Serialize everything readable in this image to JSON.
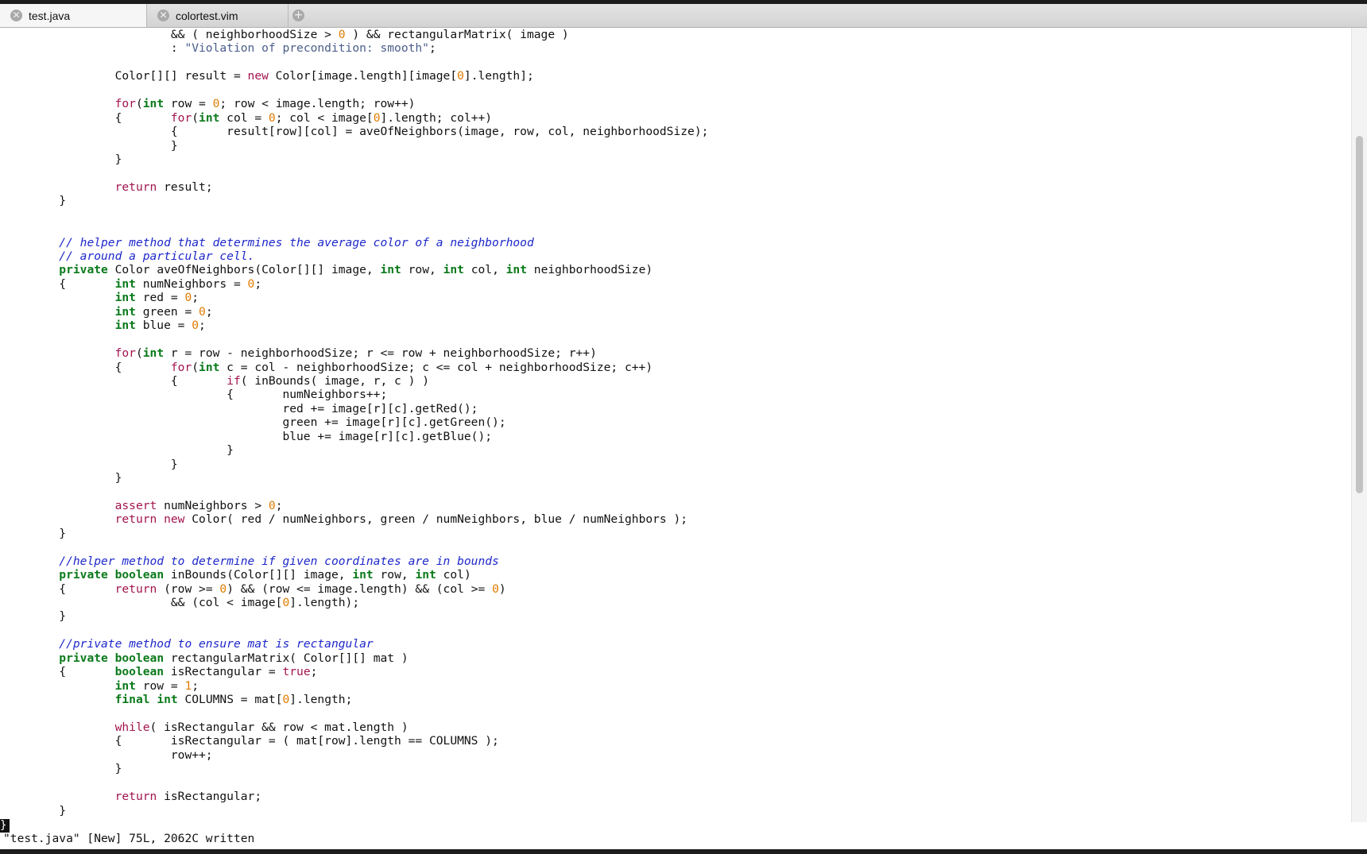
{
  "tabs": [
    {
      "label": "test.java",
      "active": true
    },
    {
      "label": "colortest.vim",
      "active": false
    }
  ],
  "status_line": "\"test.java\" [New] 75L, 2062C written",
  "cursor_char": "}",
  "code_lines": [
    [
      [
        "t",
        "                        && ( neighborhoodSize > "
      ],
      [
        "nu",
        "0"
      ],
      [
        "t",
        " ) && rectangularMatrix( image )"
      ]
    ],
    [
      [
        "t",
        "                        : "
      ],
      [
        "st",
        "\"Violation of precondition: smooth\""
      ],
      [
        "t",
        ";"
      ]
    ],
    [],
    [
      [
        "t",
        "                Color[][] result = "
      ],
      [
        "kw",
        "new"
      ],
      [
        "t",
        " Color[image.length][image["
      ],
      [
        "nu",
        "0"
      ],
      [
        "t",
        "].length];"
      ]
    ],
    [],
    [
      [
        "t",
        "                "
      ],
      [
        "kw",
        "for"
      ],
      [
        "t",
        "("
      ],
      [
        "ty",
        "int"
      ],
      [
        "t",
        " row = "
      ],
      [
        "nu",
        "0"
      ],
      [
        "t",
        "; row < image.length; row++)"
      ]
    ],
    [
      [
        "t",
        "                {       "
      ],
      [
        "kw",
        "for"
      ],
      [
        "t",
        "("
      ],
      [
        "ty",
        "int"
      ],
      [
        "t",
        " col = "
      ],
      [
        "nu",
        "0"
      ],
      [
        "t",
        "; col < image["
      ],
      [
        "nu",
        "0"
      ],
      [
        "t",
        "].length; col++)"
      ]
    ],
    [
      [
        "t",
        "                        {       result[row][col] = aveOfNeighbors(image, row, col, neighborhoodSize);"
      ]
    ],
    [
      [
        "t",
        "                        }"
      ]
    ],
    [
      [
        "t",
        "                }"
      ]
    ],
    [],
    [
      [
        "t",
        "                "
      ],
      [
        "kw",
        "return"
      ],
      [
        "t",
        " result;"
      ]
    ],
    [
      [
        "t",
        "        }"
      ]
    ],
    [],
    [],
    [
      [
        "t",
        "        "
      ],
      [
        "cm",
        "// helper method that determines the average color of a neighborhood"
      ]
    ],
    [
      [
        "t",
        "        "
      ],
      [
        "cm",
        "// around a particular cell."
      ]
    ],
    [
      [
        "t",
        "        "
      ],
      [
        "ty",
        "private"
      ],
      [
        "t",
        " Color aveOfNeighbors(Color[][] image, "
      ],
      [
        "ty",
        "int"
      ],
      [
        "t",
        " row, "
      ],
      [
        "ty",
        "int"
      ],
      [
        "t",
        " col, "
      ],
      [
        "ty",
        "int"
      ],
      [
        "t",
        " neighborhoodSize)"
      ]
    ],
    [
      [
        "t",
        "        {       "
      ],
      [
        "ty",
        "int"
      ],
      [
        "t",
        " numNeighbors = "
      ],
      [
        "nu",
        "0"
      ],
      [
        "t",
        ";"
      ]
    ],
    [
      [
        "t",
        "                "
      ],
      [
        "ty",
        "int"
      ],
      [
        "t",
        " red = "
      ],
      [
        "nu",
        "0"
      ],
      [
        "t",
        ";"
      ]
    ],
    [
      [
        "t",
        "                "
      ],
      [
        "ty",
        "int"
      ],
      [
        "t",
        " green = "
      ],
      [
        "nu",
        "0"
      ],
      [
        "t",
        ";"
      ]
    ],
    [
      [
        "t",
        "                "
      ],
      [
        "ty",
        "int"
      ],
      [
        "t",
        " blue = "
      ],
      [
        "nu",
        "0"
      ],
      [
        "t",
        ";"
      ]
    ],
    [],
    [
      [
        "t",
        "                "
      ],
      [
        "kw",
        "for"
      ],
      [
        "t",
        "("
      ],
      [
        "ty",
        "int"
      ],
      [
        "t",
        " r = row - neighborhoodSize; r <= row + neighborhoodSize; r++)"
      ]
    ],
    [
      [
        "t",
        "                {       "
      ],
      [
        "kw",
        "for"
      ],
      [
        "t",
        "("
      ],
      [
        "ty",
        "int"
      ],
      [
        "t",
        " c = col - neighborhoodSize; c <= col + neighborhoodSize; c++)"
      ]
    ],
    [
      [
        "t",
        "                        {       "
      ],
      [
        "kw",
        "if"
      ],
      [
        "t",
        "( inBounds( image, r, c ) )"
      ]
    ],
    [
      [
        "t",
        "                                {       numNeighbors++;"
      ]
    ],
    [
      [
        "t",
        "                                        red += image[r][c].getRed();"
      ]
    ],
    [
      [
        "t",
        "                                        green += image[r][c].getGreen();"
      ]
    ],
    [
      [
        "t",
        "                                        blue += image[r][c].getBlue();"
      ]
    ],
    [
      [
        "t",
        "                                }"
      ]
    ],
    [
      [
        "t",
        "                        }"
      ]
    ],
    [
      [
        "t",
        "                }"
      ]
    ],
    [],
    [
      [
        "t",
        "                "
      ],
      [
        "kw",
        "assert"
      ],
      [
        "t",
        " numNeighbors > "
      ],
      [
        "nu",
        "0"
      ],
      [
        "t",
        ";"
      ]
    ],
    [
      [
        "t",
        "                "
      ],
      [
        "kw",
        "return"
      ],
      [
        "t",
        " "
      ],
      [
        "kw",
        "new"
      ],
      [
        "t",
        " Color( red / numNeighbors, green / numNeighbors, blue / numNeighbors );"
      ]
    ],
    [
      [
        "t",
        "        }"
      ]
    ],
    [],
    [
      [
        "t",
        "        "
      ],
      [
        "cm",
        "//helper method to determine if given coordinates are in bounds"
      ]
    ],
    [
      [
        "t",
        "        "
      ],
      [
        "ty",
        "private"
      ],
      [
        "t",
        " "
      ],
      [
        "ty",
        "boolean"
      ],
      [
        "t",
        " inBounds(Color[][] image, "
      ],
      [
        "ty",
        "int"
      ],
      [
        "t",
        " row, "
      ],
      [
        "ty",
        "int"
      ],
      [
        "t",
        " col)"
      ]
    ],
    [
      [
        "t",
        "        {       "
      ],
      [
        "kw",
        "return"
      ],
      [
        "t",
        " (row >= "
      ],
      [
        "nu",
        "0"
      ],
      [
        "t",
        ") && (row <= image.length) && (col >= "
      ],
      [
        "nu",
        "0"
      ],
      [
        "t",
        ")"
      ]
    ],
    [
      [
        "t",
        "                        && (col < image["
      ],
      [
        "nu",
        "0"
      ],
      [
        "t",
        "].length);"
      ]
    ],
    [
      [
        "t",
        "        }"
      ]
    ],
    [],
    [
      [
        "t",
        "        "
      ],
      [
        "cm",
        "//private method to ensure mat is rectangular"
      ]
    ],
    [
      [
        "t",
        "        "
      ],
      [
        "ty",
        "private"
      ],
      [
        "t",
        " "
      ],
      [
        "ty",
        "boolean"
      ],
      [
        "t",
        " rectangularMatrix( Color[][] mat )"
      ]
    ],
    [
      [
        "t",
        "        {       "
      ],
      [
        "ty",
        "boolean"
      ],
      [
        "t",
        " isRectangular = "
      ],
      [
        "kw",
        "true"
      ],
      [
        "t",
        ";"
      ]
    ],
    [
      [
        "t",
        "                "
      ],
      [
        "ty",
        "int"
      ],
      [
        "t",
        " row = "
      ],
      [
        "nu",
        "1"
      ],
      [
        "t",
        ";"
      ]
    ],
    [
      [
        "t",
        "                "
      ],
      [
        "ty",
        "final"
      ],
      [
        "t",
        " "
      ],
      [
        "ty",
        "int"
      ],
      [
        "t",
        " COLUMNS = mat["
      ],
      [
        "nu",
        "0"
      ],
      [
        "t",
        "].length;"
      ]
    ],
    [],
    [
      [
        "t",
        "                "
      ],
      [
        "kw",
        "while"
      ],
      [
        "t",
        "( isRectangular && row < mat.length )"
      ]
    ],
    [
      [
        "t",
        "                {       isRectangular = ( mat[row].length == COLUMNS );"
      ]
    ],
    [
      [
        "t",
        "                        row++;"
      ]
    ],
    [
      [
        "t",
        "                }"
      ]
    ],
    [],
    [
      [
        "t",
        "                "
      ],
      [
        "kw",
        "return"
      ],
      [
        "t",
        " isRectangular;"
      ]
    ],
    [
      [
        "t",
        "        }"
      ]
    ]
  ]
}
